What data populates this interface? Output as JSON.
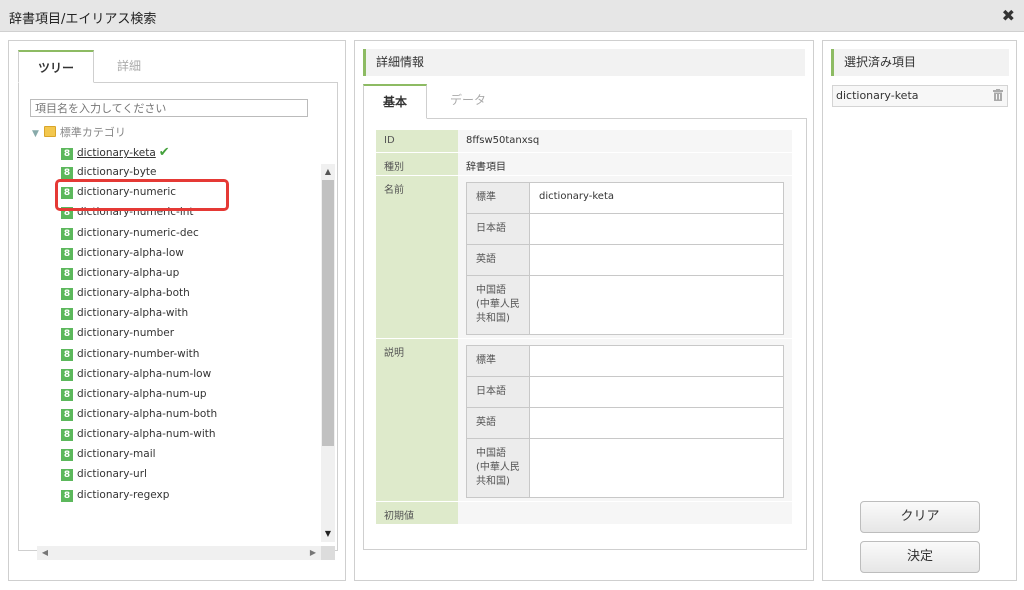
{
  "window": {
    "title": "辞書項目/エイリアス検索",
    "close_icon": "close-icon"
  },
  "left": {
    "tabs": [
      {
        "label": "ツリー"
      },
      {
        "label": "詳細"
      }
    ],
    "search": {
      "placeholder": "項目名を入力してください"
    },
    "tree": {
      "root_label": "標準カテゴリ",
      "badge": "8",
      "items": [
        "dictionary-keta",
        "dictionary-byte",
        "dictionary-numeric",
        "dictionary-numeric-int",
        "dictionary-numeric-dec",
        "dictionary-alpha-low",
        "dictionary-alpha-up",
        "dictionary-alpha-both",
        "dictionary-alpha-with",
        "dictionary-number",
        "dictionary-number-with",
        "dictionary-alpha-num-low",
        "dictionary-alpha-num-up",
        "dictionary-alpha-num-both",
        "dictionary-alpha-num-with",
        "dictionary-mail",
        "dictionary-url",
        "dictionary-regexp"
      ],
      "selected_index": 0
    }
  },
  "middle": {
    "heading": "詳細情報",
    "tabs": [
      {
        "label": "基本"
      },
      {
        "label": "データ"
      }
    ],
    "fields": {
      "id_label": "ID",
      "id_value": "8ffsw50tanxsq",
      "type_label": "種別",
      "type_value": "辞書項目",
      "name_label": "名前",
      "desc_label": "説明",
      "init_label": "初期値"
    },
    "name_rows": [
      {
        "lang": "標準",
        "value": "dictionary-keta"
      },
      {
        "lang": "日本語",
        "value": ""
      },
      {
        "lang": "英語",
        "value": ""
      },
      {
        "lang": "中国語\n(中華人民\n共和国)",
        "value": ""
      }
    ],
    "desc_rows": [
      {
        "lang": "標準",
        "value": ""
      },
      {
        "lang": "日本語",
        "value": ""
      },
      {
        "lang": "英語",
        "value": ""
      },
      {
        "lang": "中国語\n(中華人民\n共和国)",
        "value": ""
      }
    ]
  },
  "right": {
    "heading": "選択済み項目",
    "selected": [
      "dictionary-keta"
    ],
    "clear_label": "クリア",
    "ok_label": "決定"
  },
  "colors": {
    "accent": "#8dbb63",
    "badge": "#5cb85c",
    "highlight": "#e53935",
    "label_bg": "#deeacb"
  }
}
